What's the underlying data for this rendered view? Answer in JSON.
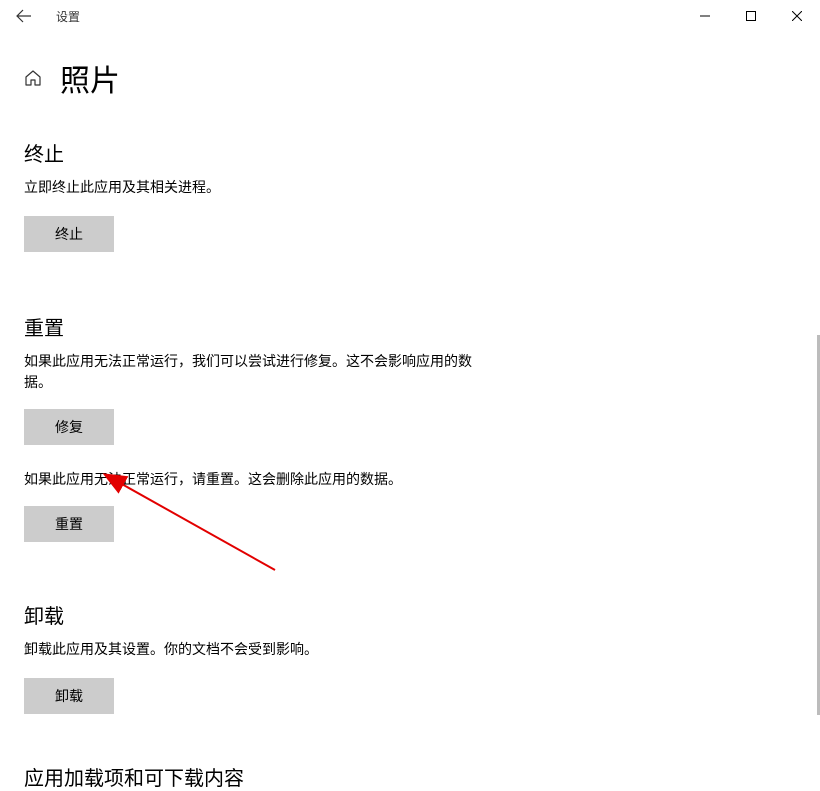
{
  "titlebar": {
    "title": "设置"
  },
  "page": {
    "title": "照片"
  },
  "sections": {
    "terminate": {
      "title": "终止",
      "desc": "立即终止此应用及其相关进程。",
      "button": "终止"
    },
    "reset": {
      "title": "重置",
      "desc1": "如果此应用无法正常运行，我们可以尝试进行修复。这不会影响应用的数据。",
      "button1": "修复",
      "desc2": "如果此应用无法正常运行，请重置。这会删除此应用的数据。",
      "button2": "重置"
    },
    "uninstall": {
      "title": "卸载",
      "desc": "卸载此应用及其设置。你的文档不会受到影响。",
      "button": "卸载"
    },
    "addons": {
      "title": "应用加载项和可下载内容"
    }
  }
}
